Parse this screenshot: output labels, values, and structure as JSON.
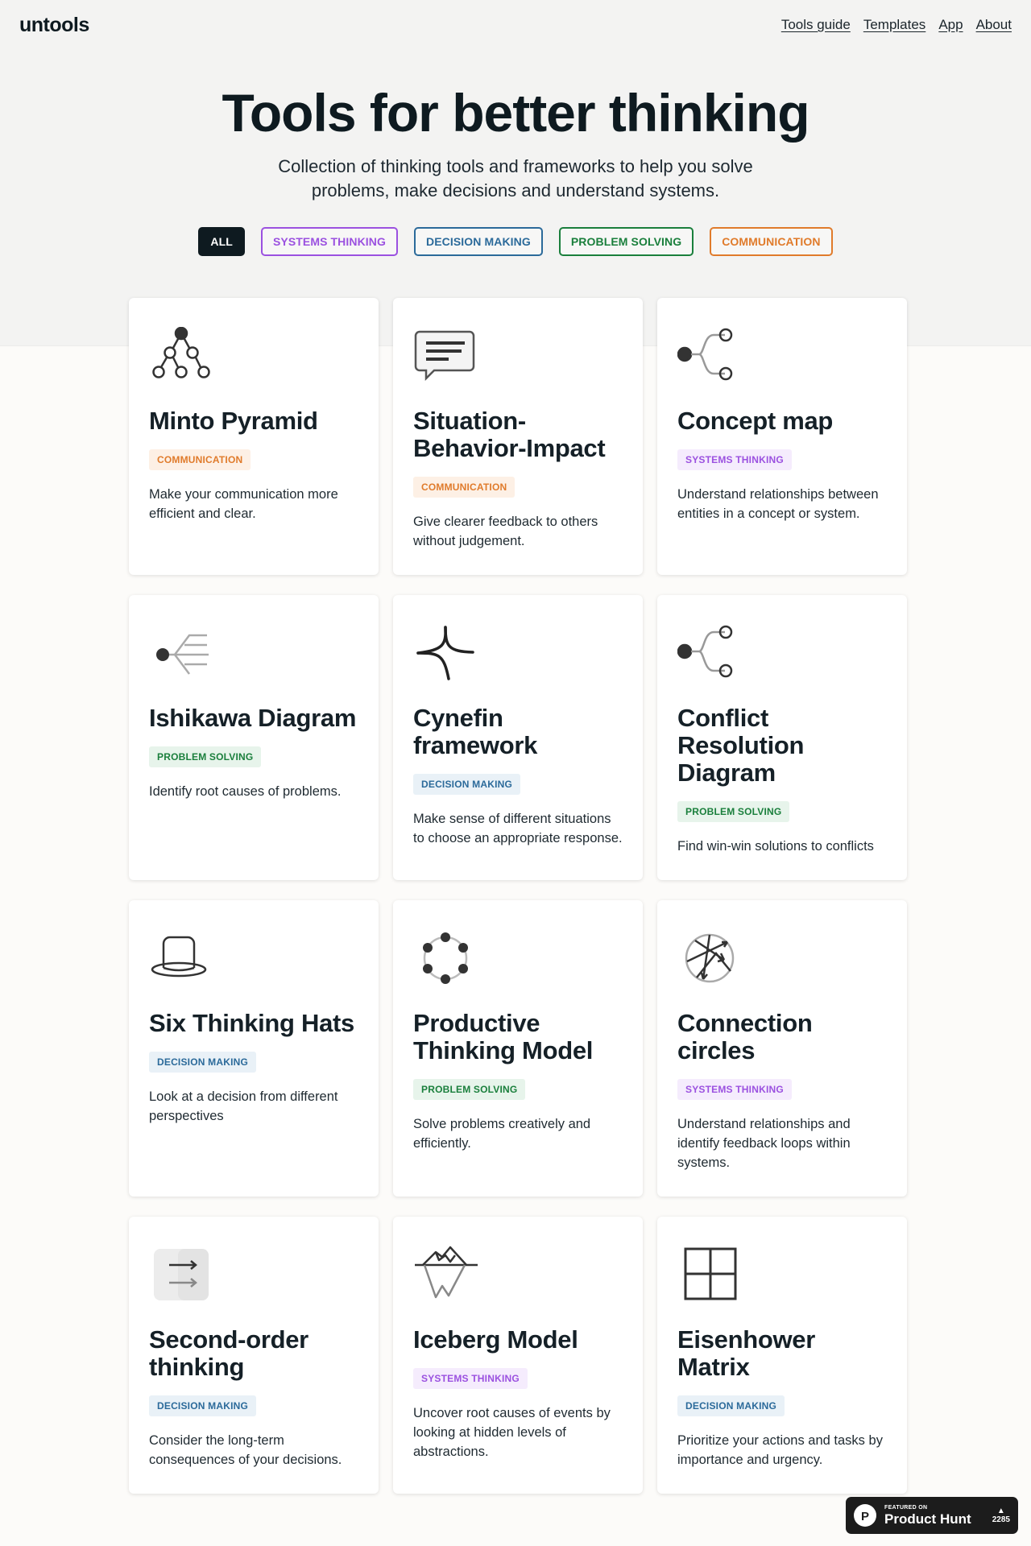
{
  "header": {
    "logo": "untools",
    "nav": [
      "Tools guide",
      "Templates",
      "App",
      "About"
    ]
  },
  "hero": {
    "title": "Tools for better thinking",
    "subtitle": "Collection of thinking tools and frameworks to help you solve problems, make decisions and understand systems."
  },
  "filters": [
    "ALL",
    "SYSTEMS THINKING",
    "DECISION MAKING",
    "PROBLEM SOLVING",
    "COMMUNICATION"
  ],
  "cards": [
    {
      "title": "Minto Pyramid",
      "tag": "COMMUNICATION",
      "desc": "Make your communication more efficient and clear.",
      "icon": "pyramid-icon"
    },
    {
      "title": "Situation-Behavior-Impact",
      "tag": "COMMUNICATION",
      "desc": "Give clearer feedback to others without judgement.",
      "icon": "speech-bubble-icon"
    },
    {
      "title": "Concept map",
      "tag": "SYSTEMS THINKING",
      "desc": "Understand relationships between entities in a concept or system.",
      "icon": "branch-icon"
    },
    {
      "title": "Ishikawa Diagram",
      "tag": "PROBLEM SOLVING",
      "desc": "Identify root causes of problems.",
      "icon": "fishbone-icon"
    },
    {
      "title": "Cynefin framework",
      "tag": "DECISION MAKING",
      "desc": "Make sense of different situations to choose an appropriate response.",
      "icon": "cynefin-icon"
    },
    {
      "title": "Conflict Resolution Diagram",
      "tag": "PROBLEM SOLVING",
      "desc": "Find win-win solutions to conflicts",
      "icon": "branch-icon"
    },
    {
      "title": "Six Thinking Hats",
      "tag": "DECISION MAKING",
      "desc": "Look at a decision from different perspectives",
      "icon": "hat-icon"
    },
    {
      "title": "Productive Thinking Model",
      "tag": "PROBLEM SOLVING",
      "desc": "Solve problems creatively and efficiently.",
      "icon": "circle-dots-icon"
    },
    {
      "title": "Connection circles",
      "tag": "SYSTEMS THINKING",
      "desc": "Understand relationships and identify feedback loops within systems.",
      "icon": "connection-circle-icon"
    },
    {
      "title": "Second-order thinking",
      "tag": "DECISION MAKING",
      "desc": "Consider the long-term consequences of your decisions.",
      "icon": "arrows-icon"
    },
    {
      "title": "Iceberg Model",
      "tag": "SYSTEMS THINKING",
      "desc": "Uncover root causes of events by looking at hidden levels of abstractions.",
      "icon": "iceberg-icon"
    },
    {
      "title": "Eisenhower Matrix",
      "tag": "DECISION MAKING",
      "desc": "Prioritize your actions and tasks by importance and urgency.",
      "icon": "grid-icon"
    }
  ],
  "product_hunt": {
    "featured": "FEATURED ON",
    "name": "Product Hunt",
    "votes": "2285"
  }
}
